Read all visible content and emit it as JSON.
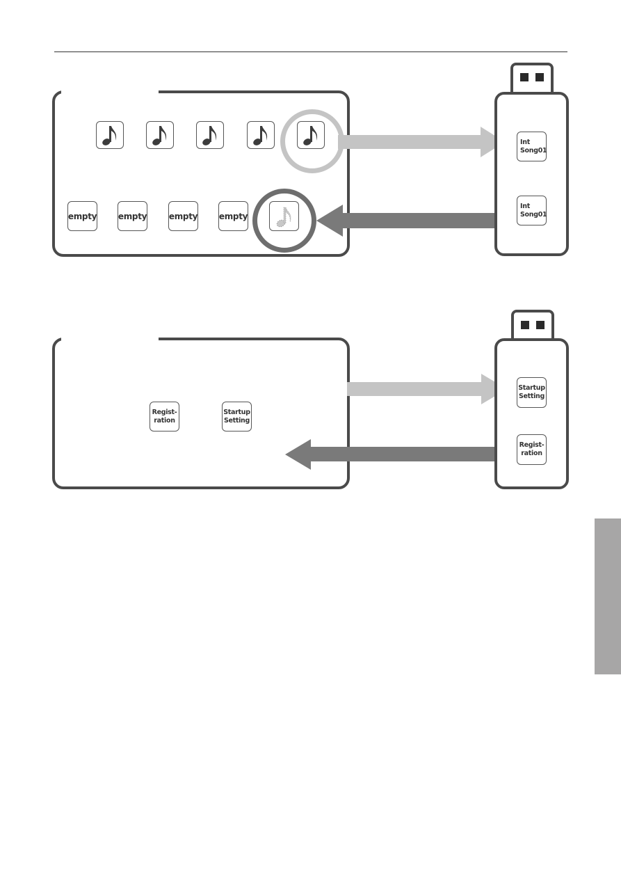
{
  "colors": {
    "outline": "#4a4a4a",
    "arrow_light": "#c4c4c4",
    "arrow_dark": "#7a7a7a",
    "ring_light": "#c4c4c4",
    "ring_dark": "#6e6e6e",
    "side_tab": "#a7a6a6"
  },
  "diagram1": {
    "instrument_panel": {
      "song_slots": [
        {
          "icon": "eighth-note-icon"
        },
        {
          "icon": "eighth-note-icon"
        },
        {
          "icon": "eighth-note-icon"
        },
        {
          "icon": "eighth-note-icon"
        },
        {
          "icon": "eighth-note-icon",
          "highlighted": true
        }
      ],
      "empty_slots": [
        {
          "label": "empty"
        },
        {
          "label": "empty"
        },
        {
          "label": "empty"
        },
        {
          "label": "empty"
        }
      ],
      "loaded_slot": {
        "icon": "dotted-eighth-note-icon",
        "highlighted": true
      }
    },
    "usb_drive": {
      "files": [
        {
          "line1": "Int",
          "line2": "Song01"
        },
        {
          "line1": "Int",
          "line2": "Song01"
        }
      ]
    },
    "arrows": {
      "save": "to-usb",
      "load": "from-usb"
    }
  },
  "diagram2": {
    "instrument_panel": {
      "items": [
        {
          "line1": "Regist-",
          "line2": "ration"
        },
        {
          "line1": "Startup",
          "line2": "Setting"
        }
      ]
    },
    "usb_drive": {
      "files": [
        {
          "line1": "Startup",
          "line2": "Setting"
        },
        {
          "line1": "Regist-",
          "line2": "ration"
        }
      ]
    },
    "arrows": {
      "save": "to-usb",
      "load": "from-usb"
    }
  }
}
